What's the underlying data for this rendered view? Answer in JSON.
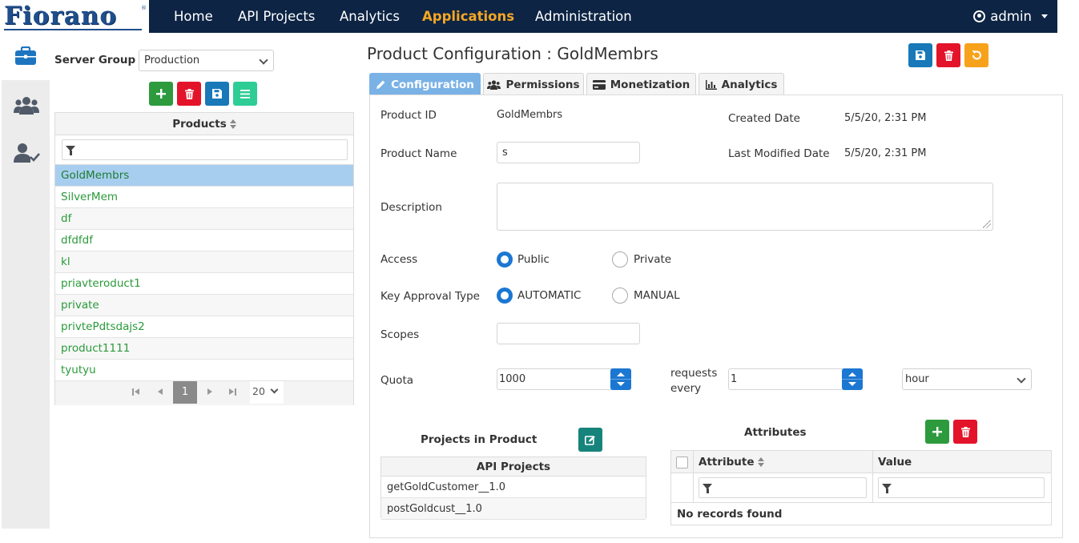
{
  "brand": {
    "name": "Fiorano",
    "accent": "#f5a623",
    "navbar_bg": "#0d2444"
  },
  "nav": {
    "items": [
      {
        "label": "Home"
      },
      {
        "label": "API Projects"
      },
      {
        "label": "Analytics"
      },
      {
        "label": "Applications"
      },
      {
        "label": "Administration"
      }
    ],
    "active": "Applications",
    "user": "admin"
  },
  "sidebar": {
    "icons": [
      "briefcase-icon",
      "users-icon",
      "user-check-icon"
    ]
  },
  "products_panel": {
    "server_group_label": "Server Group",
    "server_group_value": "Production",
    "toolbar_icons": [
      "plus-icon",
      "trash-icon",
      "save-icon",
      "list-icon"
    ],
    "column_header": "Products",
    "selected": "GoldMembrs",
    "items": [
      "GoldMembrs",
      "SilverMem",
      "df",
      "dfdfdf",
      "kl",
      "priavteroduct1",
      "private",
      "privtePdtsdajs2",
      "product1111",
      "tyutyu"
    ],
    "pager": {
      "current_page": "1",
      "page_size": "20"
    }
  },
  "main": {
    "title": "Product Configuration : GoldMembrs",
    "header_actions": [
      "save-icon",
      "trash-icon",
      "undo-icon"
    ],
    "tabs": [
      {
        "label": "Configuration",
        "icon": "pencil-icon"
      },
      {
        "label": "Permissions",
        "icon": "users-icon"
      },
      {
        "label": "Monetization",
        "icon": "credit-card-icon"
      },
      {
        "label": "Analytics",
        "icon": "bar-chart-icon"
      }
    ],
    "active_tab": "Configuration",
    "form": {
      "product_id_label": "Product ID",
      "product_id_value": "GoldMembrs",
      "created_date_label": "Created Date",
      "created_date_value": "5/5/20, 2:31 PM",
      "product_name_label": "Product Name",
      "product_name_value": "s",
      "last_modified_label": "Last Modified Date",
      "last_modified_value": "5/5/20, 2:31 PM",
      "description_label": "Description",
      "description_value": "",
      "access_label": "Access",
      "access_options": [
        "Public",
        "Private"
      ],
      "access_selected": "Public",
      "key_approval_label": "Key Approval Type",
      "key_approval_options": [
        "AUTOMATIC",
        "MANUAL"
      ],
      "key_approval_selected": "AUTOMATIC",
      "scopes_label": "Scopes",
      "scopes_value": "",
      "quota_label": "Quota",
      "quota_value": "1000",
      "requests_every_label": "requests every",
      "interval_value": "1",
      "interval_unit": "hour"
    },
    "projects": {
      "title": "Projects in Product",
      "edit_icon": "edit-icon",
      "column_header": "API Projects",
      "rows": [
        "getGoldCustomer__1.0",
        "postGoldcust__1.0"
      ]
    },
    "attributes": {
      "title": "Attributes",
      "actions": [
        "plus-icon",
        "trash-icon"
      ],
      "columns": [
        "Attribute",
        "Value"
      ],
      "empty_message": "No records found"
    }
  }
}
